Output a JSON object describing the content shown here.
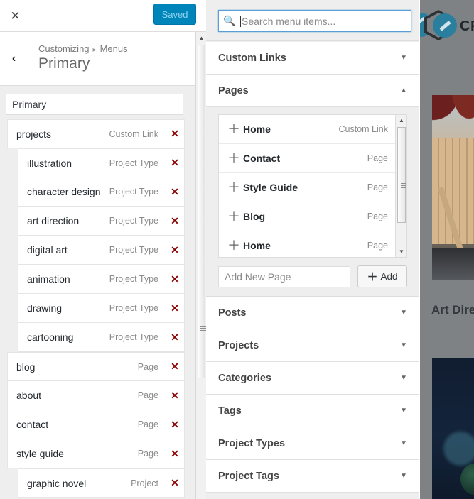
{
  "customizer": {
    "close_icon": "close-icon",
    "close_label": "✕",
    "save_button_label": "Saved",
    "back_icon_label": "‹",
    "breadcrumb": {
      "root": "Customizing",
      "separator": "▸",
      "current": "Menus"
    },
    "panel_title": "Primary",
    "menu_name_value": "Primary",
    "menu_items": [
      {
        "title": "projects",
        "type": "Custom Link",
        "depth": 0,
        "remove_label": "✕"
      },
      {
        "title": "illustration",
        "type": "Project Type",
        "depth": 1,
        "remove_label": "✕"
      },
      {
        "title": "character design",
        "type": "Project Type",
        "depth": 1,
        "remove_label": "✕"
      },
      {
        "title": "art direction",
        "type": "Project Type",
        "depth": 1,
        "remove_label": "✕"
      },
      {
        "title": "digital art",
        "type": "Project Type",
        "depth": 1,
        "remove_label": "✕"
      },
      {
        "title": "animation",
        "type": "Project Type",
        "depth": 1,
        "remove_label": "✕"
      },
      {
        "title": "drawing",
        "type": "Project Type",
        "depth": 1,
        "remove_label": "✕"
      },
      {
        "title": "cartooning",
        "type": "Project Type",
        "depth": 1,
        "remove_label": "✕"
      },
      {
        "title": "blog",
        "type": "Page",
        "depth": 0,
        "remove_label": "✕"
      },
      {
        "title": "about",
        "type": "Page",
        "depth": 0,
        "remove_label": "✕"
      },
      {
        "title": "contact",
        "type": "Page",
        "depth": 0,
        "remove_label": "✕"
      },
      {
        "title": "style guide",
        "type": "Page",
        "depth": 0,
        "remove_label": "✕"
      },
      {
        "title": "graphic novel",
        "type": "Project",
        "depth": 1,
        "remove_label": "✕"
      }
    ],
    "scrollbar": {
      "up_arrow": "▲",
      "down_arrow": "▼"
    }
  },
  "add_panel": {
    "search": {
      "placeholder": "Search menu items...",
      "value": "",
      "icon": "search-icon"
    },
    "sections": [
      {
        "label": "Custom Links",
        "expanded": false,
        "chevron": "▼"
      },
      {
        "label": "Pages",
        "expanded": true,
        "chevron": "▲"
      },
      {
        "label": "Posts",
        "expanded": false,
        "chevron": "▼"
      },
      {
        "label": "Projects",
        "expanded": false,
        "chevron": "▼"
      },
      {
        "label": "Categories",
        "expanded": false,
        "chevron": "▼"
      },
      {
        "label": "Tags",
        "expanded": false,
        "chevron": "▼"
      },
      {
        "label": "Project Types",
        "expanded": false,
        "chevron": "▼"
      },
      {
        "label": "Project Tags",
        "expanded": false,
        "chevron": "▼"
      }
    ],
    "pages_items": [
      {
        "name": "Home",
        "type": "Custom Link",
        "add_icon": "＋"
      },
      {
        "name": "Contact",
        "type": "Page",
        "add_icon": "＋"
      },
      {
        "name": "Style Guide",
        "type": "Page",
        "add_icon": "＋"
      },
      {
        "name": "Blog",
        "type": "Page",
        "add_icon": "＋"
      },
      {
        "name": "Home",
        "type": "Page",
        "add_icon": "＋"
      }
    ],
    "new_page": {
      "placeholder": "Add New Page",
      "value": "",
      "add_button_label": "Add",
      "add_button_icon": "＋"
    },
    "list_scrollbar": {
      "up_arrow": "▲",
      "down_arrow": "▼"
    }
  },
  "preview": {
    "brand_text": "CR",
    "caption": "Art Dire",
    "logo_icon": "pencil-hexagon-logo-icon"
  },
  "colors": {
    "accent_blue": "#0085ba",
    "saved_text": "#8fd3ef",
    "remove_red": "#8b0000",
    "panel_bg": "#eeeeee",
    "preview_bg": "#7e8285",
    "focus_border": "#5b9dd9"
  }
}
